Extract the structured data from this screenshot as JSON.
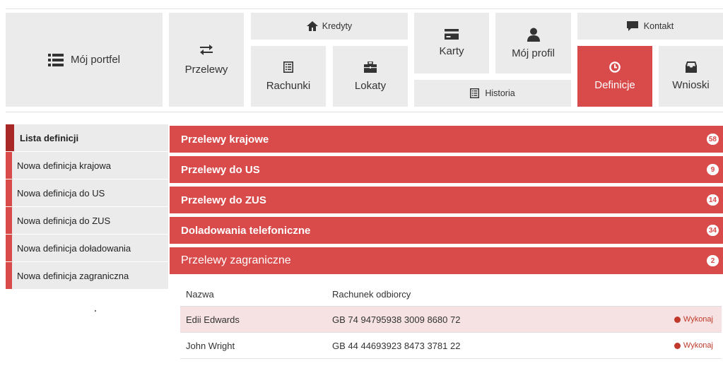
{
  "nav": {
    "portfel": "Mój portfel",
    "przelewy": "Przelewy",
    "kredyty": "Kredyty",
    "rachunki": "Rachunki",
    "lokaty": "Lokaty",
    "karty": "Karty",
    "profil": "Mój profil",
    "historia": "Historia",
    "kontakt": "Kontakt",
    "definicje": "Definicje",
    "wnioski": "Wnioski"
  },
  "sidebar": {
    "items": [
      {
        "label": "Lista definicji"
      },
      {
        "label": "Nowa definicja krajowa"
      },
      {
        "label": "Nowa definicja do US"
      },
      {
        "label": "Nowa definicja do ZUS"
      },
      {
        "label": "Nowa definicja doładowania"
      },
      {
        "label": "Nowa definicja zagraniczna"
      }
    ]
  },
  "panels": [
    {
      "title": "Przelewy krajowe",
      "count": "58"
    },
    {
      "title": "Przelewy do US",
      "count": "9"
    },
    {
      "title": "Przelewy do ZUS",
      "count": "14"
    },
    {
      "title": "Doladowania telefoniczne",
      "count": "34"
    },
    {
      "title": "Przelewy zagraniczne",
      "count": "2"
    }
  ],
  "table": {
    "col_name": "Nazwa",
    "col_account": "Rachunek odbiorcy",
    "rows": [
      {
        "name": "Edii Edwards",
        "account": "GB 74 94795938 3009 8680 72",
        "action": "Wykonaj"
      },
      {
        "name": "John Wright",
        "account": "GB 44 44693923 8473 3781 22",
        "action": "Wykonaj"
      }
    ]
  },
  "colors": {
    "accent": "#d94a4a",
    "accent_dark": "#a82828",
    "tile_bg": "#ebebeb",
    "row_highlight": "#f6e2e2"
  },
  "icons": [
    "list-icon",
    "transfer-arrows-icon",
    "home-icon",
    "document-icon",
    "briefcase-icon",
    "card-icon",
    "user-icon",
    "speech-bubble-icon",
    "clock-icon",
    "inbox-icon"
  ]
}
